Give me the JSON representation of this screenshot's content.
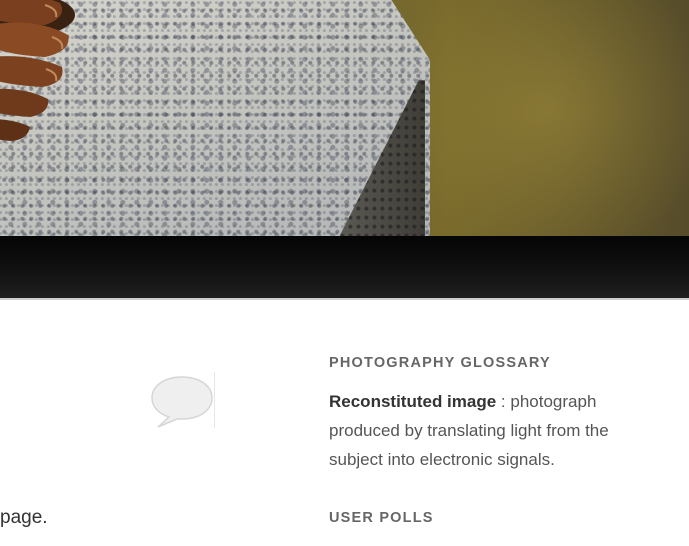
{
  "hero": {
    "image": "pinecone-on-granite-photo"
  },
  "main": {
    "page_fragment": "page."
  },
  "comments": {
    "icon": "speech-bubble-icon"
  },
  "sidebar": {
    "glossary": {
      "title": "PHOTOGRAPHY GLOSSARY",
      "term": "Reconstituted image",
      "separator": " : ",
      "definition": "photograph produced by translating light from the subject into electronic signals."
    },
    "polls": {
      "title": "USER POLLS"
    }
  }
}
